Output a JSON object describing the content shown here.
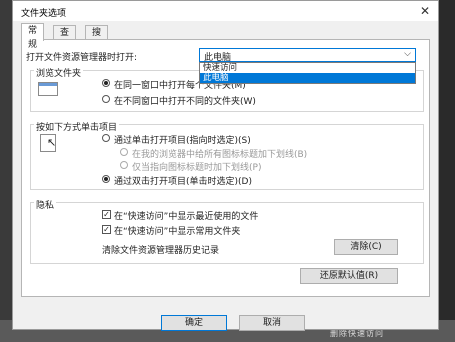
{
  "window": {
    "title": "文件夹选项",
    "close_glyph": "✕"
  },
  "tabs": [
    {
      "label": "常规"
    },
    {
      "label": "查看"
    },
    {
      "label": "搜索"
    }
  ],
  "open_explorer": {
    "label": "打开文件资源管理器时打开:",
    "value": "此电脑",
    "options": [
      "快速访问",
      "此电脑"
    ]
  },
  "browse": {
    "title": "浏览文件夹",
    "same_window": "在同一窗口中打开每个文件夹(M)",
    "diff_window": "在不同窗口中打开不同的文件夹(W)"
  },
  "click": {
    "title": "按如下方式单击项目",
    "single": "通过单击打开项目(指向时选定)(S)",
    "underline_all": "在我的浏览器中给所有图标标题加下划线(B)",
    "underline_point": "仅当指向图标标题时加下划线(P)",
    "double": "通过双击打开项目(单击时选定)(D)"
  },
  "privacy": {
    "title": "隐私",
    "recent_files": "在“快速访问”中显示最近使用的文件",
    "frequent_folders": "在“快速访问”中显示常用文件夹",
    "clear_history_label": "清除文件资源管理器历史记录",
    "clear_button": "清除(C)"
  },
  "restore_button": "还原默认值(R)",
  "footer": {
    "ok": "确定",
    "cancel": "取消"
  },
  "background_text": "删除快速访问"
}
